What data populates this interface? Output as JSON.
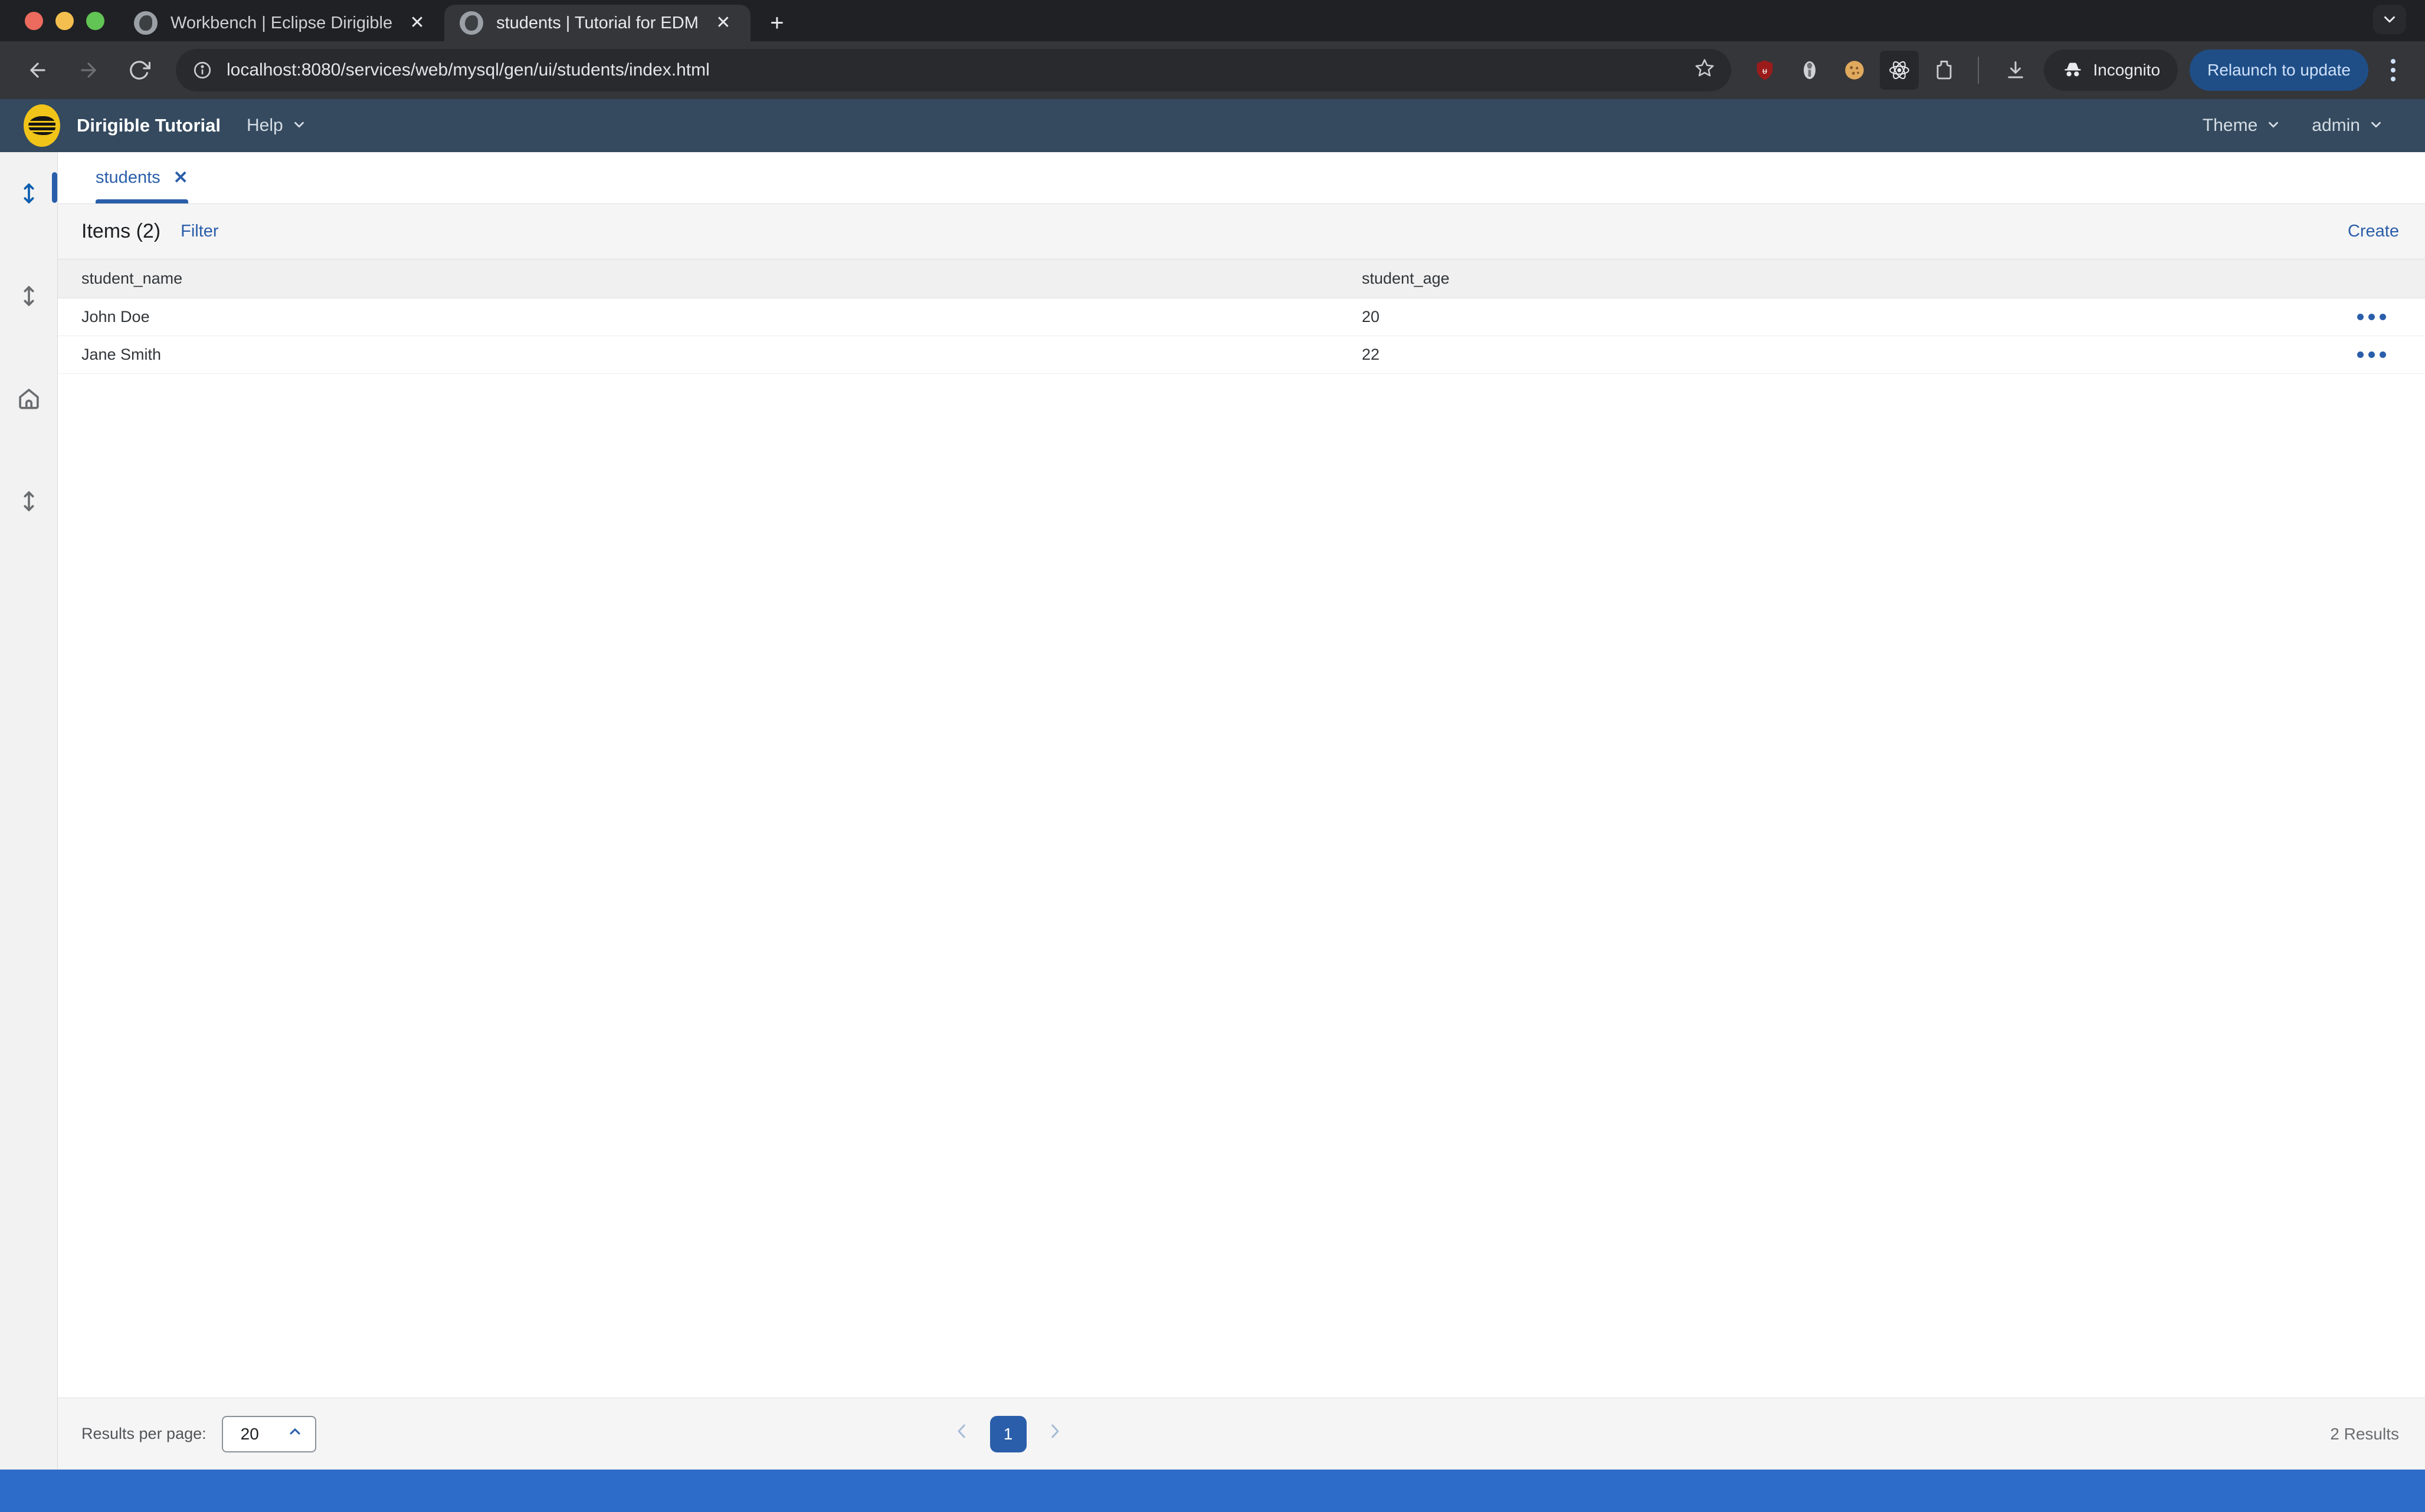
{
  "browser": {
    "tabs": [
      {
        "title": "Workbench | Eclipse Dirigible",
        "favicon": "globe-icon",
        "close": "✕",
        "active": false
      },
      {
        "title": "students | Tutorial for EDM",
        "favicon": "globe-icon",
        "close": "✕",
        "active": true
      }
    ],
    "new_tab_label": "+",
    "tab_search_icon": "chevron-down-icon",
    "nav": {
      "back_icon": "arrow-left-icon",
      "forward_icon": "arrow-right-icon",
      "reload_icon": "reload-icon"
    },
    "omnibox": {
      "site_info_icon": "info-circle-icon",
      "url": "localhost:8080/services/web/mysql/gen/ui/students/index.html",
      "bookmark_icon": "star-icon"
    },
    "extensions": [
      {
        "name": "ublock-origin-icon",
        "glyph": "ᵾ"
      },
      {
        "name": "tools-extension-icon",
        "glyph": "⚲"
      },
      {
        "name": "cookie-extension-icon",
        "glyph": "🍪"
      },
      {
        "name": "react-devtools-icon",
        "glyph": "⚛"
      },
      {
        "name": "extensions-puzzle-icon",
        "glyph": "⬒"
      }
    ],
    "download_icon": "download-icon",
    "incognito_label": "Incognito",
    "incognito_icon": "incognito-icon",
    "relaunch_label": "Relaunch to update",
    "menu_icon": "kebab-menu-icon"
  },
  "app": {
    "logo": "dirigible-logo",
    "title": "Dirigible Tutorial",
    "help_label": "Help",
    "theme_label": "Theme",
    "user_label": "admin",
    "sidebar": [
      {
        "name": "sidebar-item-resize-1",
        "icon": "resize-vertical-icon",
        "active": true
      },
      {
        "name": "sidebar-item-resize-2",
        "icon": "resize-vertical-icon",
        "active": false
      },
      {
        "name": "sidebar-item-home",
        "icon": "home-icon",
        "active": false
      },
      {
        "name": "sidebar-item-resize-3",
        "icon": "resize-vertical-icon",
        "active": false
      }
    ],
    "workspace_tabs": [
      {
        "label": "students",
        "close": "✕",
        "active": true
      }
    ],
    "toolbar": {
      "items_label": "Items (2)",
      "filter_label": "Filter",
      "create_label": "Create"
    },
    "table": {
      "columns": [
        "student_name",
        "student_age"
      ],
      "rows": [
        {
          "student_name": "John Doe",
          "student_age": "20",
          "actions_icon": "more-horizontal-icon"
        },
        {
          "student_name": "Jane Smith",
          "student_age": "22",
          "actions_icon": "more-horizontal-icon"
        }
      ]
    },
    "footer": {
      "results_per_page_label": "Results per page:",
      "results_per_page_value": "20",
      "results_per_page_chevron": "chevron-up-icon",
      "prev_icon": "chevron-left-icon",
      "next_icon": "chevron-right-icon",
      "current_page": "1",
      "results_label": "2 Results"
    }
  },
  "colors": {
    "brand_blue": "#2a5eaa",
    "header_navy": "#354a5f",
    "logo_yellow": "#f0c419",
    "status_blue": "#2e6cc9",
    "chrome_dark": "#202124"
  }
}
